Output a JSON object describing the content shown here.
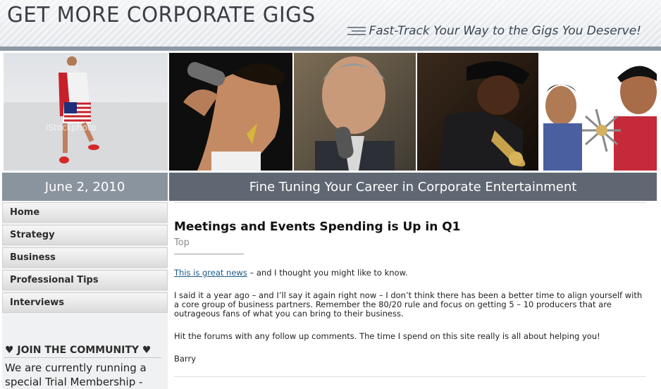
{
  "header": {
    "title": "GET MORE CORPORATE GIGS",
    "tagline": "Fast-Track Your Way to the Gigs You Deserve!"
  },
  "photos": [
    {
      "name": "man-flag-shorts-photo",
      "watermark": "iStockphoto"
    },
    {
      "name": "woman-singer-photo"
    },
    {
      "name": "man-speaker-photo"
    },
    {
      "name": "trumpet-player-photo"
    },
    {
      "name": "performers-photo"
    }
  ],
  "date": "June 2, 2010",
  "banner": "Fine Tuning Your Career in Corporate Entertainment",
  "sidebar": {
    "nav": [
      {
        "label": "Home"
      },
      {
        "label": "Strategy"
      },
      {
        "label": "Business"
      },
      {
        "label": "Professional Tips"
      },
      {
        "label": "Interviews"
      }
    ],
    "community_title": "♥ JOIN THE COMMUNITY ♥",
    "community_text": "We are currently running a special Trial Membership -"
  },
  "article": {
    "title": "Meetings and Events Spending is Up in Q1",
    "top_link": "Top",
    "link_text": "This is great news",
    "intro_rest": " – and I thought you might like to know.",
    "para2": "I said it a year ago – and I’ll say it again right now – I don’t think there has been a better time to align yourself with a core group of business partners.  Remember the 80/20 rule and focus on getting 5 – 10 producers that are outrageous fans of what you can bring to their business.",
    "para3": "Hit the forums with any follow up comments. The time I spend on this site really is all about helping you!",
    "signature": "Barry"
  }
}
